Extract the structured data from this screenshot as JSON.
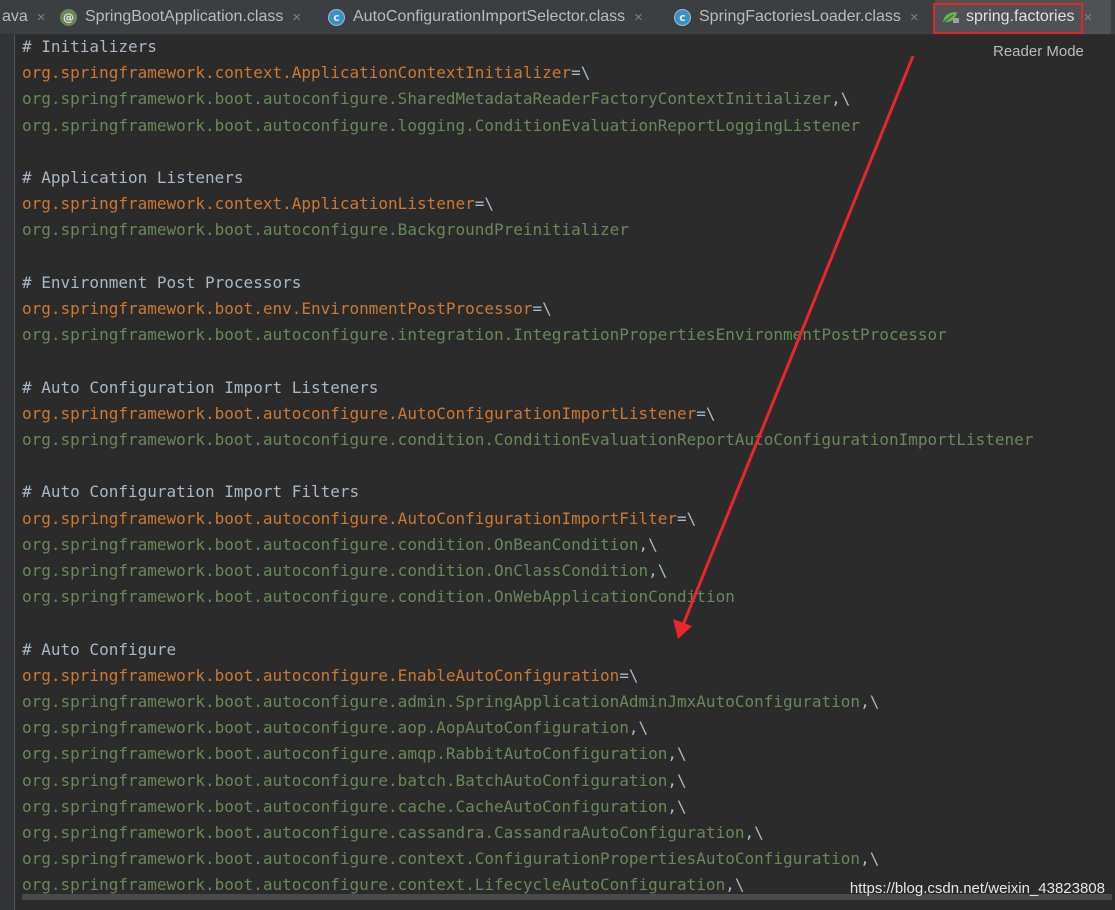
{
  "tabs": [
    {
      "label": "ava",
      "icon": "",
      "active": false
    },
    {
      "label": "SpringBootApplication.class",
      "icon": "annotation-icon",
      "active": false
    },
    {
      "label": "AutoConfigurationImportSelector.class",
      "icon": "class-icon",
      "active": false
    },
    {
      "label": "SpringFactoriesLoader.class",
      "icon": "class-icon",
      "active": false
    },
    {
      "label": "spring.factories",
      "icon": "spring-leaf-icon",
      "active": true
    }
  ],
  "close_glyph": "×",
  "reader_mode_label": "Reader Mode",
  "code_lines": [
    {
      "type": "comment",
      "text": "# Initializers"
    },
    {
      "type": "key",
      "text": "org.springframework.context.ApplicationContextInitializer",
      "suffix": "=\\"
    },
    {
      "type": "val",
      "text": "org.springframework.boot.autoconfigure.SharedMetadataReaderFactoryContextInitializer",
      "suffix": ",\\"
    },
    {
      "type": "val",
      "text": "org.springframework.boot.autoconfigure.logging.ConditionEvaluationReportLoggingListener",
      "suffix": ""
    },
    {
      "type": "blank",
      "text": ""
    },
    {
      "type": "comment",
      "text": "# Application Listeners"
    },
    {
      "type": "key",
      "text": "org.springframework.context.ApplicationListener",
      "suffix": "=\\"
    },
    {
      "type": "val",
      "text": "org.springframework.boot.autoconfigure.BackgroundPreinitializer",
      "suffix": ""
    },
    {
      "type": "blank",
      "text": ""
    },
    {
      "type": "comment",
      "text": "# Environment Post Processors"
    },
    {
      "type": "key",
      "text": "org.springframework.boot.env.EnvironmentPostProcessor",
      "suffix": "=\\"
    },
    {
      "type": "val",
      "text": "org.springframework.boot.autoconfigure.integration.IntegrationPropertiesEnvironmentPostProcessor",
      "suffix": ""
    },
    {
      "type": "blank",
      "text": ""
    },
    {
      "type": "comment",
      "text": "# Auto Configuration Import Listeners"
    },
    {
      "type": "key",
      "text": "org.springframework.boot.autoconfigure.AutoConfigurationImportListener",
      "suffix": "=\\"
    },
    {
      "type": "val",
      "text": "org.springframework.boot.autoconfigure.condition.ConditionEvaluationReportAutoConfigurationImportListener",
      "suffix": ""
    },
    {
      "type": "blank",
      "text": ""
    },
    {
      "type": "comment",
      "text": "# Auto Configuration Import Filters"
    },
    {
      "type": "key",
      "text": "org.springframework.boot.autoconfigure.AutoConfigurationImportFilter",
      "suffix": "=\\"
    },
    {
      "type": "val",
      "text": "org.springframework.boot.autoconfigure.condition.OnBeanCondition",
      "suffix": ",\\"
    },
    {
      "type": "val",
      "text": "org.springframework.boot.autoconfigure.condition.OnClassCondition",
      "suffix": ",\\"
    },
    {
      "type": "val",
      "text": "org.springframework.boot.autoconfigure.condition.OnWebApplicationCondition",
      "suffix": ""
    },
    {
      "type": "blank",
      "text": ""
    },
    {
      "type": "comment",
      "text": "# Auto Configure"
    },
    {
      "type": "key",
      "text": "org.springframework.boot.autoconfigure.EnableAutoConfiguration",
      "suffix": "=\\"
    },
    {
      "type": "val",
      "text": "org.springframework.boot.autoconfigure.admin.SpringApplicationAdminJmxAutoConfiguration",
      "suffix": ",\\"
    },
    {
      "type": "val",
      "text": "org.springframework.boot.autoconfigure.aop.AopAutoConfiguration",
      "suffix": ",\\"
    },
    {
      "type": "val",
      "text": "org.springframework.boot.autoconfigure.amqp.RabbitAutoConfiguration",
      "suffix": ",\\"
    },
    {
      "type": "val",
      "text": "org.springframework.boot.autoconfigure.batch.BatchAutoConfiguration",
      "suffix": ",\\"
    },
    {
      "type": "val",
      "text": "org.springframework.boot.autoconfigure.cache.CacheAutoConfiguration",
      "suffix": ",\\"
    },
    {
      "type": "val",
      "text": "org.springframework.boot.autoconfigure.cassandra.CassandraAutoConfiguration",
      "suffix": ",\\"
    },
    {
      "type": "val",
      "text": "org.springframework.boot.autoconfigure.context.ConfigurationPropertiesAutoConfiguration",
      "suffix": ",\\"
    },
    {
      "type": "val",
      "text": "org.springframework.boot.autoconfigure.context.LifecycleAutoConfiguration",
      "suffix": ",\\"
    }
  ],
  "watermark": "https://blog.csdn.net/weixin_43823808",
  "colors": {
    "background": "#2b2b2b",
    "comment": "#a9b7c6",
    "key": "#cc7832",
    "value": "#6a8759",
    "annotation_arrow": "#e8262c"
  }
}
